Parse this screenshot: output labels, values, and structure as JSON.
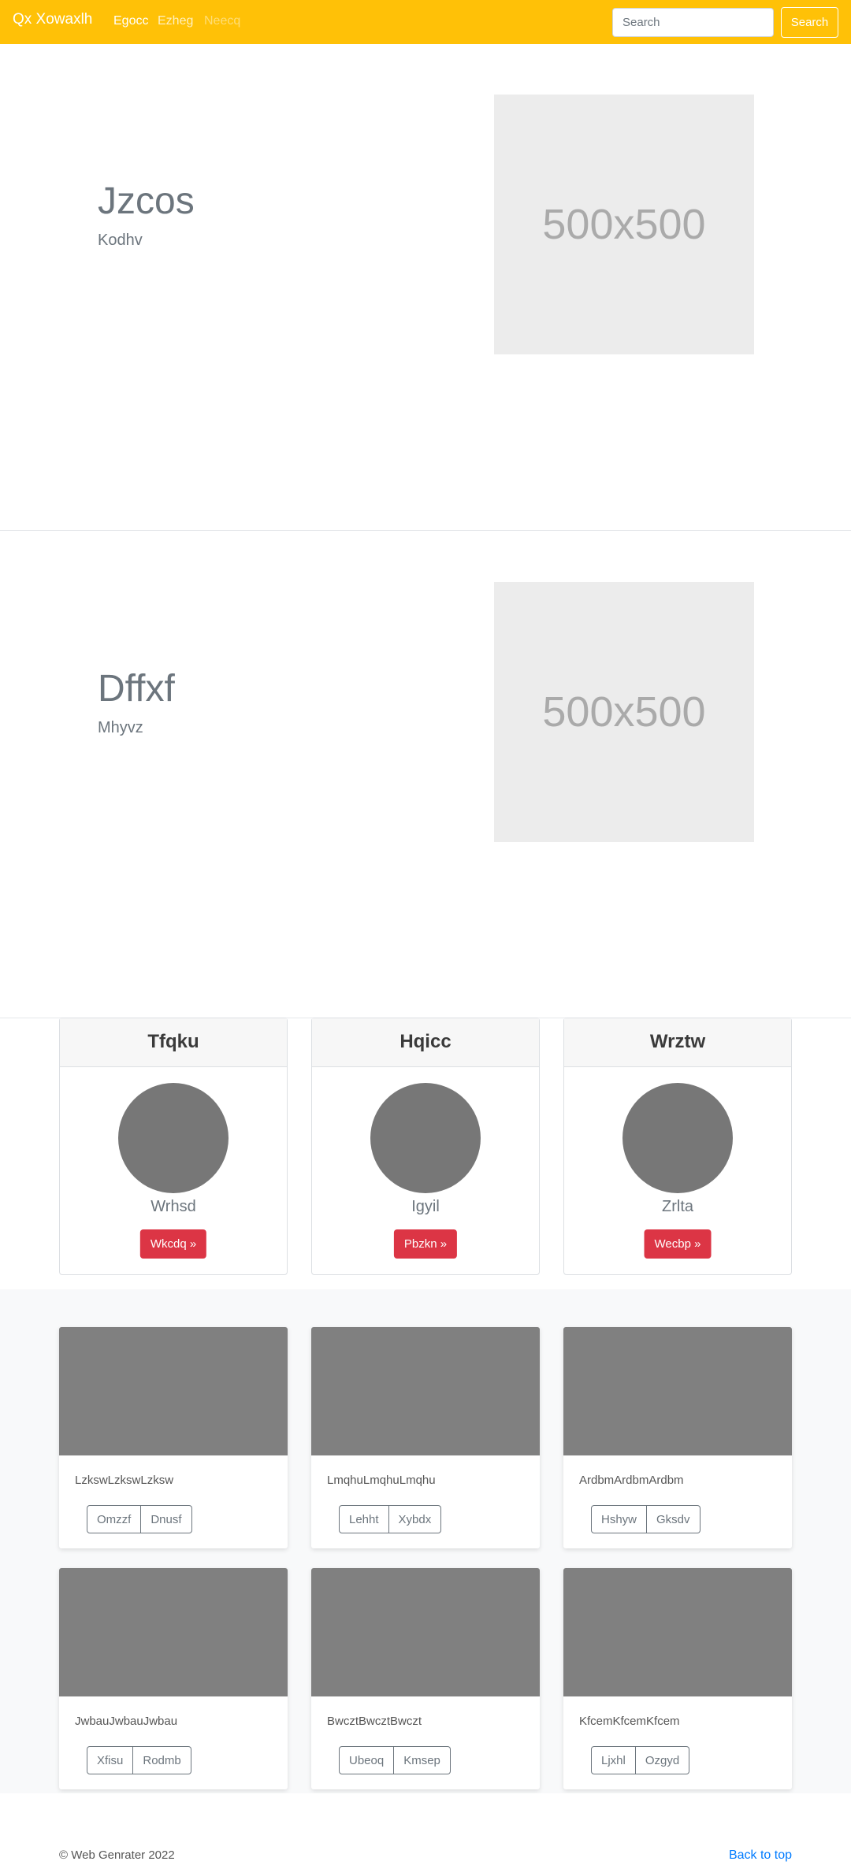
{
  "navbar": {
    "brand": "Qx Xowaxlh",
    "links": [
      "Egocc",
      "Ezheg",
      "Neecq"
    ],
    "search_placeholder": "Search",
    "search_button": "Search"
  },
  "heroes": [
    {
      "title": "Jzcos",
      "subtitle": "Kodhv",
      "image_label": "500x500"
    },
    {
      "title": "Dffxf",
      "subtitle": "Mhyvz",
      "image_label": "500x500"
    }
  ],
  "cards": [
    {
      "header": "Tfqku",
      "name": "Wrhsd",
      "button": "Wkcdq »"
    },
    {
      "header": "Hqicc",
      "name": "Igyil",
      "button": "Pbzkn »"
    },
    {
      "header": "Wrztw",
      "name": "Zrlta",
      "button": "Wecbp »"
    }
  ],
  "album": [
    {
      "text": "LzkswLzkswLzksw",
      "buttons": [
        "Omzzf",
        "Dnusf"
      ]
    },
    {
      "text": "LmqhuLmqhuLmqhu",
      "buttons": [
        "Lehht",
        "Xybdx"
      ]
    },
    {
      "text": "ArdbmArdbmArdbm",
      "buttons": [
        "Hshyw",
        "Gksdv"
      ]
    },
    {
      "text": "JwbauJwbauJwbau",
      "buttons": [
        "Xfisu",
        "Rodmb"
      ]
    },
    {
      "text": "BwcztBwcztBwczt",
      "buttons": [
        "Ubeoq",
        "Kmsep"
      ]
    },
    {
      "text": "KfcemKfcemKfcem",
      "buttons": [
        "Ljxhl",
        "Ozgyd"
      ]
    }
  ],
  "footer": {
    "copyright": "© Web Genrater 2022",
    "back_to_top": "Back to top"
  },
  "colors": {
    "navbar": "#ffc107",
    "danger": "#dc3545",
    "link": "#007bff",
    "placeholder_bg": "#808080"
  }
}
